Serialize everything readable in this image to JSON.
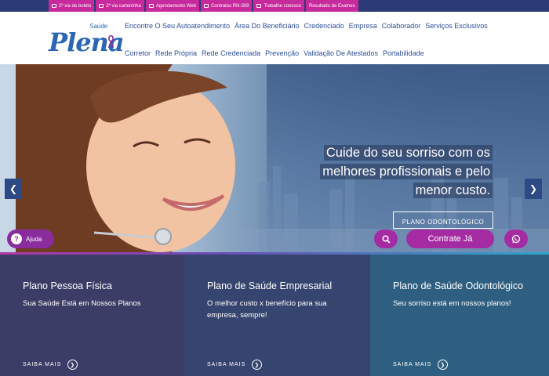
{
  "topbar": {
    "links": [
      {
        "label": "2ª via de boleto",
        "icon": "printer-icon"
      },
      {
        "label": "2ª via carteirinha",
        "icon": "id-card-icon"
      },
      {
        "label": "Agendamento Web",
        "icon": "calendar-icon"
      },
      {
        "label": "Contratos RN-309",
        "icon": "gear-icon"
      },
      {
        "label": "Trabalhe conosco",
        "icon": "envelope-icon"
      },
      {
        "label": "Resultado de Exames",
        "icon": ""
      }
    ]
  },
  "logo": {
    "brand": "Plena",
    "sub": "Saúde"
  },
  "nav": {
    "row1": [
      "Encontre O Seu Autoatendimento",
      "Área Do Beneficiário",
      "Credenciado",
      "Empresa",
      "Colaborador",
      "Serviços Exclusivos"
    ],
    "row2": [
      "Corretor",
      "Rede Própria",
      "Rede Credenciada",
      "Prevenção",
      "Validação De Atestados",
      "Portabilidade"
    ]
  },
  "hero": {
    "headline_lines": [
      "Cuide do seu sorriso com os",
      "melhores profissionais e pelo",
      "menor custo."
    ],
    "tag": "PLANO ODONTOLÓGICO",
    "cta": "Contrate Já",
    "help": "Ajuda",
    "prev_icon": "chevron-left-icon",
    "next_icon": "chevron-right-icon"
  },
  "cards": [
    {
      "title": "Plano Pessoa Física",
      "desc": "Sua Saúde Está em Nossos Planos",
      "more": "SAIBA MAIS"
    },
    {
      "title": "Plano de Saúde Empresarial",
      "desc": "O melhor custo x benefício para sua empresa, sempre!",
      "more": "SAIBA MAIS"
    },
    {
      "title": "Plano de Saúde Odontológico",
      "desc": "Seu sorriso está em nossos planos!",
      "more": "SAIBA MAIS"
    }
  ],
  "colors": {
    "brand_blue": "#2a66b4",
    "accent_magenta": "#a52ba3",
    "topbar": "#2c3a78"
  }
}
